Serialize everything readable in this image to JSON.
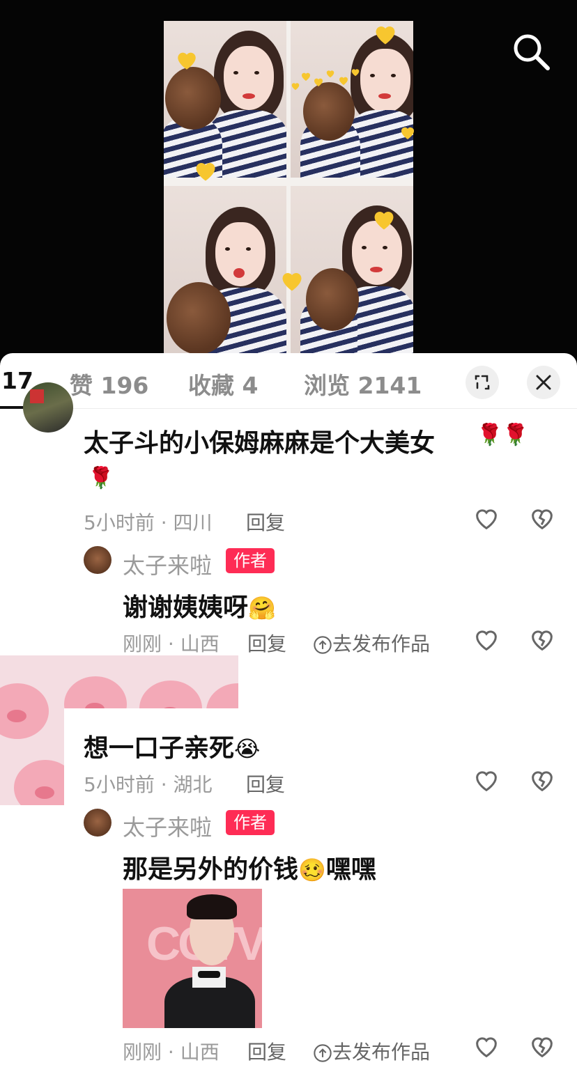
{
  "stats": {
    "comments_count": "17",
    "likes": "赞 196",
    "favorites": "收藏 4",
    "views": "浏览 2141"
  },
  "comments": [
    {
      "text": "太子斗的小保姆麻麻是个大美女",
      "emoji": "🌹🌹🌹",
      "meta": "5小时前 · 四川",
      "reply_label": "回复",
      "replies": [
        {
          "author": "太子来啦",
          "badge": "作者",
          "text": "谢谢姨姨呀",
          "emoji": "🤗",
          "meta": "刚刚 · 山西",
          "reply_label": "回复",
          "publish_label": "去发布作品"
        }
      ]
    },
    {
      "text": "想一口子亲死",
      "emoji": "😭",
      "meta": "5小时前 · 湖北",
      "reply_label": "回复",
      "replies": [
        {
          "author": "太子来啦",
          "badge": "作者",
          "text": "那是另外的价钱",
          "emoji": "🥴",
          "text_suffix": "嘿嘿",
          "meta": "刚刚 · 山西",
          "reply_label": "回复",
          "publish_label": "去发布作品",
          "image_text": "CCTV"
        }
      ]
    }
  ],
  "colors": {
    "badge": "#fe2c55",
    "heart_yellow": "#f7c62f",
    "active_tab": "#111111",
    "muted": "#9a9a9a"
  },
  "icons": {
    "search": "search-icon",
    "expand": "expand-icon",
    "close": "close-icon",
    "like": "heart-outline-icon",
    "dislike": "broken-heart-icon",
    "publish": "upload-circle-icon"
  }
}
